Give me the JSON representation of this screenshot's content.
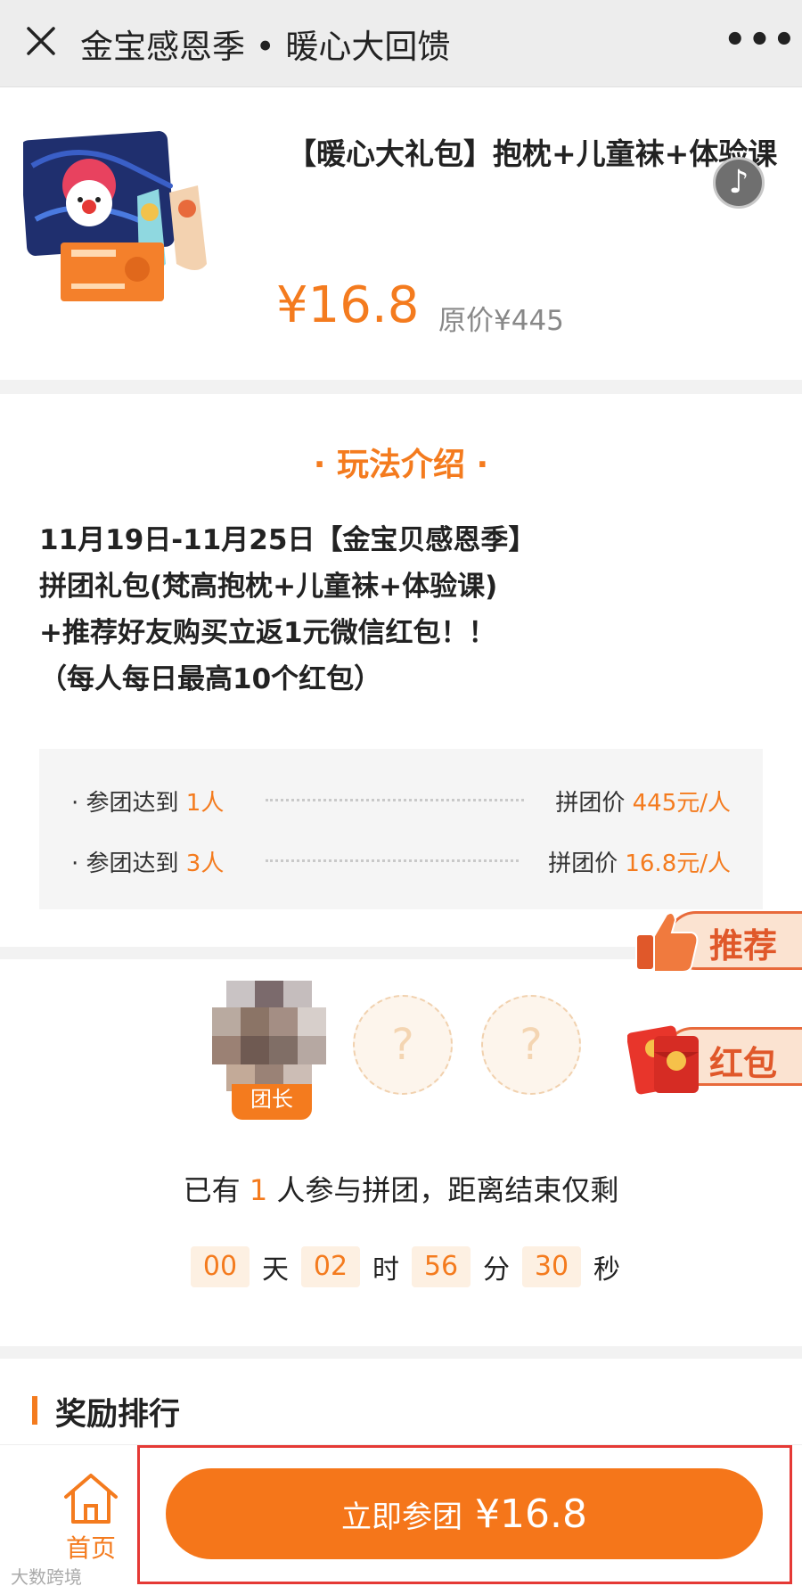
{
  "header": {
    "title": "金宝感恩季 • 暖心大回馈",
    "more_label": "•••"
  },
  "product": {
    "name": "【暖心大礼包】抱枕+儿童袜+体验课",
    "price": "¥16.8",
    "original_price": "原价¥445",
    "image_icon": "product-image",
    "music_icon": "♪"
  },
  "rules": {
    "title": "· 玩法介绍 ·",
    "desc": [
      "11月19日-11月25日【金宝贝感恩季】",
      "拼团礼包(梵高抱枕+儿童袜+体验课)",
      "+推荐好友购买立返1元微信红包！！",
      "（每人每日最高10个红包）"
    ],
    "tiers": [
      {
        "label": "· 参团达到 ",
        "count": "1人",
        "price_label": "拼团价 ",
        "price": "445元/人"
      },
      {
        "label": "· 参团达到 ",
        "count": "3人",
        "price_label": "拼团价 ",
        "price": "16.8元/人"
      }
    ]
  },
  "group": {
    "leader_tag": "团长",
    "empty_slot": "?",
    "joined_prefix": "已有 ",
    "joined_count": "1",
    "joined_suffix": " 人参与拼团，距离结束仅剩",
    "countdown": {
      "days": "00",
      "days_unit": "天",
      "hours": "02",
      "hours_unit": "时",
      "minutes": "56",
      "minutes_unit": "分",
      "seconds": "30",
      "seconds_unit": "秒"
    }
  },
  "floating": {
    "recommend_label": "推荐",
    "redpack_label": "红包"
  },
  "ranking": {
    "title": "奖励排行"
  },
  "bottom": {
    "home_label": "首页",
    "join_label": "立即参团",
    "join_price": "¥16.8",
    "watermark": "大数跨境"
  },
  "colors": {
    "accent": "#f47b1e",
    "button": "#f5761a",
    "frame": "#e53935"
  }
}
